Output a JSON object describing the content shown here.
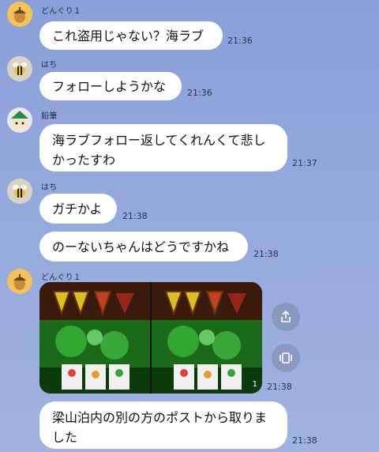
{
  "messages": [
    {
      "sender": "どんぐり１",
      "text": "これ盗用じゃない？海ラブ",
      "time": "21:36"
    },
    {
      "sender": "はち",
      "text": "フォローしようかな",
      "time": "21:36"
    },
    {
      "sender": "鉛筆",
      "line1": "海ラブフォロー返してくれんくて悲し",
      "line2": "かったすわ",
      "time": "21:37"
    },
    {
      "sender": "はち",
      "text": "ガチかよ",
      "time": "21:38"
    },
    {
      "text": "のーないちゃんはどうですかね",
      "time": "21:38"
    },
    {
      "sender": "どんぐり１",
      "image_count": "1",
      "time": "21:38"
    },
    {
      "line1": "梁山泊内の別の方のポストから取りま",
      "line2": "した",
      "time": "21:38"
    }
  ],
  "icons": {
    "share": "share-icon",
    "save": "save-icon",
    "acorn": "acorn-avatar",
    "bee": "bee-avatar",
    "pencil": "pencil-avatar"
  },
  "colors": {
    "bubble": "#ffffff",
    "background_top": "#8a9fd8",
    "background_bottom": "#9fb3e0"
  }
}
